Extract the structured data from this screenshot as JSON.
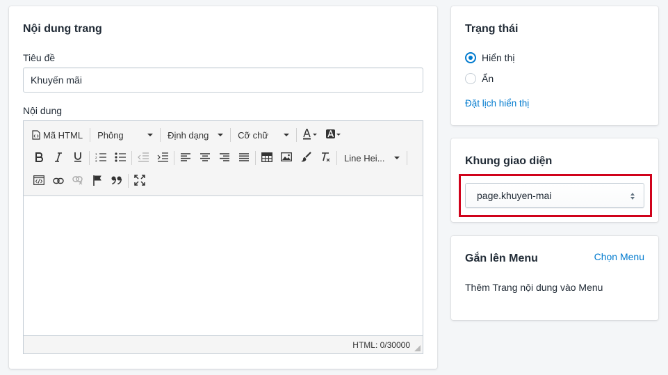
{
  "content_card": {
    "title": "Nội dung trang",
    "title_field": {
      "label": "Tiêu đề",
      "value": "Khuyến mãi"
    },
    "content_field": {
      "label": "Nội dung"
    }
  },
  "editor": {
    "toolbar": {
      "html_button": "Mã HTML",
      "font_dropdown": "Phông",
      "format_dropdown": "Định dạng",
      "size_dropdown": "Cỡ chữ",
      "line_height_dropdown": "Line Hei..."
    },
    "status": "HTML: 0/30000"
  },
  "status_card": {
    "title": "Trạng thái",
    "options": [
      {
        "label": "Hiển thị",
        "checked": true
      },
      {
        "label": "Ẩn",
        "checked": false
      }
    ],
    "schedule_link": "Đặt lịch hiển thị"
  },
  "template_card": {
    "title": "Khung giao diện",
    "selected": "page.khuyen-mai"
  },
  "menu_card": {
    "title": "Gắn lên Menu",
    "choose_link": "Chọn Menu",
    "description": "Thêm Trang nội dung vào Menu"
  },
  "colors": {
    "accent": "#007ace",
    "highlight_border": "#d0021b",
    "background": "#f4f6f8"
  },
  "icons": [
    "html-icon",
    "bold-icon",
    "italic-icon",
    "underline-icon",
    "ordered-list-icon",
    "bullet-list-icon",
    "outdent-icon",
    "indent-icon",
    "align-left-icon",
    "align-center-icon",
    "align-right-icon",
    "align-justify-icon",
    "table-icon",
    "image-icon",
    "paint-brush-icon",
    "clear-format-icon",
    "source-code-icon",
    "link-icon",
    "unlink-icon",
    "flag-icon",
    "quote-icon",
    "fullscreen-icon",
    "text-color-icon",
    "background-color-icon"
  ]
}
